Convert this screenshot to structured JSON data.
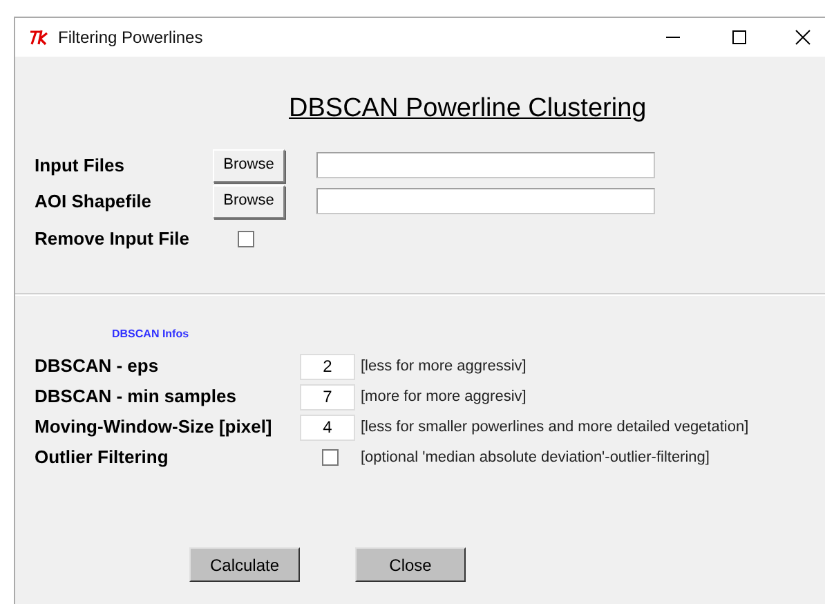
{
  "window": {
    "title": "Filtering Powerlines"
  },
  "heading": "DBSCAN Powerline Clustering",
  "file_rows": [
    {
      "label": "Input Files",
      "button": "Browse"
    },
    {
      "label": "AOI Shapefile",
      "button": "Browse"
    }
  ],
  "remove_input_file": {
    "label": "Remove Input File",
    "checked": false
  },
  "infos_label": "DBSCAN Infos",
  "parameters": [
    {
      "kind": "entry",
      "label": "DBSCAN - eps",
      "value": "2",
      "hint": "[less for more aggressiv]"
    },
    {
      "kind": "entry",
      "label": "DBSCAN - min samples",
      "value": "7",
      "hint": "[more for more aggresiv]"
    },
    {
      "kind": "entry",
      "label": "Moving-Window-Size [pixel]",
      "value": "4",
      "hint": "[less for smaller powerlines and more detailed vegetation]"
    },
    {
      "kind": "checkbox",
      "label": "Outlier Filtering",
      "checked": false,
      "hint": "[optional 'median absolute deviation'-outlier-filtering]"
    }
  ],
  "buttons": [
    "Calculate",
    "Close"
  ]
}
